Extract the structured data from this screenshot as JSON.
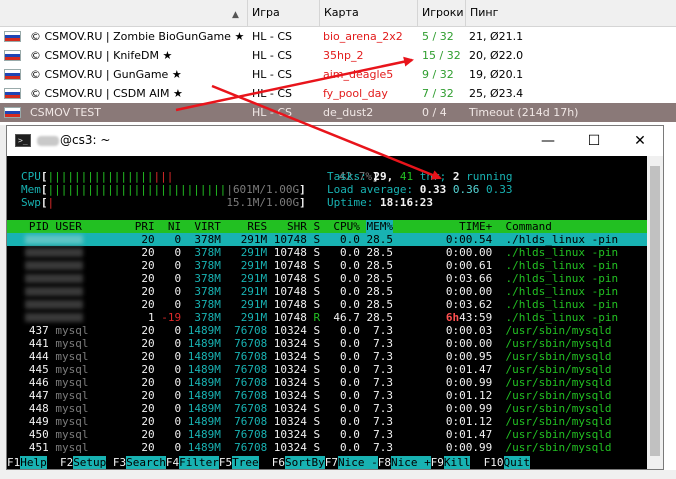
{
  "browser": {
    "columns": {
      "game": "Игра",
      "map": "Карта",
      "players": "Игроки",
      "ping": "Пинг"
    },
    "rows": [
      {
        "name": "© CSMOV.RU | Zombie BioGunGame ★",
        "game": "HL - CS",
        "map": "bio_arena_2x2",
        "players": "5 / 32",
        "ping": "21, Ø21.1"
      },
      {
        "name": "© CSMOV.RU | KnifeDM ★",
        "game": "HL - CS",
        "map": "35hp_2",
        "players": "15 / 32",
        "ping": "20, Ø22.0"
      },
      {
        "name": "© CSMOV.RU | GunGame ★",
        "game": "HL - CS",
        "map": "aim_deagle5",
        "players": "9 / 32",
        "ping": "19, Ø20.1"
      },
      {
        "name": "© CSMOV.RU | CSDM AIM ★",
        "game": "HL - CS",
        "map": "fy_pool_day",
        "players": "7 / 32",
        "ping": "25, Ø23.4"
      },
      {
        "name": "CSMOV TEST",
        "game": "HL - CS",
        "map": "de_dust2",
        "players": "0 / 4",
        "ping": "Timeout (214d 17h)"
      }
    ]
  },
  "window": {
    "title": "@cs3: ~",
    "minimize": "—",
    "maximize": "☐",
    "close": "✕"
  },
  "meters": {
    "cpu_label": "CPU",
    "cpu_value": "42.7%",
    "mem_label": "Mem",
    "mem_value": "601M/1.00G",
    "swp_label": "Swp",
    "swp_value": "15.1M/1.00G"
  },
  "summary": {
    "tasks_label": "Tasks:",
    "tasks_count": "29,",
    "thr_count": "41",
    "thr_label": "thr;",
    "running_count": "2",
    "running_label": "running",
    "load_label": "Load average:",
    "load1": "0.33",
    "load5": "0.36",
    "load15": "0.33",
    "uptime_label": "Uptime:",
    "uptime": "18:16:23"
  },
  "table": {
    "headers": [
      "PID",
      "USER",
      "PRI",
      "NI",
      "VIRT",
      "RES",
      "SHR",
      "S",
      "CPU%",
      "MEM%",
      "TIME+",
      "Command"
    ],
    "rows": [
      {
        "pid": "",
        "user": "",
        "pri": "20",
        "ni": "0",
        "virt": "378M",
        "res": "291M",
        "shr": "10748",
        "s": "S",
        "cpu": "0.0",
        "mem": "28.5",
        "time": "0:00.54",
        "cmd": "./hlds_linux -pin"
      },
      {
        "pid": "",
        "user": "",
        "pri": "20",
        "ni": "0",
        "virt": "378M",
        "res": "291M",
        "shr": "10748",
        "s": "S",
        "cpu": "0.0",
        "mem": "28.5",
        "time": "0:00.00",
        "cmd": "./hlds_linux -pin"
      },
      {
        "pid": "",
        "user": "",
        "pri": "20",
        "ni": "0",
        "virt": "378M",
        "res": "291M",
        "shr": "10748",
        "s": "S",
        "cpu": "0.0",
        "mem": "28.5",
        "time": "0:00.61",
        "cmd": "./hlds_linux -pin"
      },
      {
        "pid": "",
        "user": "",
        "pri": "20",
        "ni": "0",
        "virt": "378M",
        "res": "291M",
        "shr": "10748",
        "s": "S",
        "cpu": "0.0",
        "mem": "28.5",
        "time": "0:03.66",
        "cmd": "./hlds_linux -pin"
      },
      {
        "pid": "",
        "user": "",
        "pri": "20",
        "ni": "0",
        "virt": "378M",
        "res": "291M",
        "shr": "10748",
        "s": "S",
        "cpu": "0.0",
        "mem": "28.5",
        "time": "0:00.00",
        "cmd": "./hlds_linux -pin"
      },
      {
        "pid": "",
        "user": "",
        "pri": "20",
        "ni": "0",
        "virt": "378M",
        "res": "291M",
        "shr": "10748",
        "s": "S",
        "cpu": "0.0",
        "mem": "28.5",
        "time": "0:03.62",
        "cmd": "./hlds_linux -pin"
      },
      {
        "pid": "",
        "user": "",
        "pri": "1",
        "ni": "-19",
        "virt": "378M",
        "res": "291M",
        "shr": "10748",
        "s": "R",
        "cpu": "46.7",
        "mem": "28.5",
        "time_h": "6h",
        "time": "43:59",
        "cmd": "./hlds_linux -pin"
      },
      {
        "pid": "437",
        "user": "mysql",
        "pri": "20",
        "ni": "0",
        "virt": "1489M",
        "res": "76708",
        "shr": "10324",
        "s": "S",
        "cpu": "0.0",
        "mem": "7.3",
        "time": "0:00.03",
        "cmd": "/usr/sbin/mysqld"
      },
      {
        "pid": "441",
        "user": "mysql",
        "pri": "20",
        "ni": "0",
        "virt": "1489M",
        "res": "76708",
        "shr": "10324",
        "s": "S",
        "cpu": "0.0",
        "mem": "7.3",
        "time": "0:00.00",
        "cmd": "/usr/sbin/mysqld"
      },
      {
        "pid": "444",
        "user": "mysql",
        "pri": "20",
        "ni": "0",
        "virt": "1489M",
        "res": "76708",
        "shr": "10324",
        "s": "S",
        "cpu": "0.0",
        "mem": "7.3",
        "time": "0:00.95",
        "cmd": "/usr/sbin/mysqld"
      },
      {
        "pid": "445",
        "user": "mysql",
        "pri": "20",
        "ni": "0",
        "virt": "1489M",
        "res": "76708",
        "shr": "10324",
        "s": "S",
        "cpu": "0.0",
        "mem": "7.3",
        "time": "0:01.47",
        "cmd": "/usr/sbin/mysqld"
      },
      {
        "pid": "446",
        "user": "mysql",
        "pri": "20",
        "ni": "0",
        "virt": "1489M",
        "res": "76708",
        "shr": "10324",
        "s": "S",
        "cpu": "0.0",
        "mem": "7.3",
        "time": "0:00.99",
        "cmd": "/usr/sbin/mysqld"
      },
      {
        "pid": "447",
        "user": "mysql",
        "pri": "20",
        "ni": "0",
        "virt": "1489M",
        "res": "76708",
        "shr": "10324",
        "s": "S",
        "cpu": "0.0",
        "mem": "7.3",
        "time": "0:01.12",
        "cmd": "/usr/sbin/mysqld"
      },
      {
        "pid": "448",
        "user": "mysql",
        "pri": "20",
        "ni": "0",
        "virt": "1489M",
        "res": "76708",
        "shr": "10324",
        "s": "S",
        "cpu": "0.0",
        "mem": "7.3",
        "time": "0:00.99",
        "cmd": "/usr/sbin/mysqld"
      },
      {
        "pid": "449",
        "user": "mysql",
        "pri": "20",
        "ni": "0",
        "virt": "1489M",
        "res": "76708",
        "shr": "10324",
        "s": "S",
        "cpu": "0.0",
        "mem": "7.3",
        "time": "0:01.12",
        "cmd": "/usr/sbin/mysqld"
      },
      {
        "pid": "450",
        "user": "mysql",
        "pri": "20",
        "ni": "0",
        "virt": "1489M",
        "res": "76708",
        "shr": "10324",
        "s": "S",
        "cpu": "0.0",
        "mem": "7.3",
        "time": "0:01.47",
        "cmd": "/usr/sbin/mysqld"
      },
      {
        "pid": "451",
        "user": "mysql",
        "pri": "20",
        "ni": "0",
        "virt": "1489M",
        "res": "76708",
        "shr": "10324",
        "s": "S",
        "cpu": "0.0",
        "mem": "7.3",
        "time": "0:00.99",
        "cmd": "/usr/sbin/mysqld"
      }
    ]
  },
  "fkeys": [
    {
      "key": "F1",
      "label": "Help"
    },
    {
      "key": "F2",
      "label": "Setup"
    },
    {
      "key": "F3",
      "label": "Search"
    },
    {
      "key": "F4",
      "label": "Filter"
    },
    {
      "key": "F5",
      "label": "Tree"
    },
    {
      "key": "F6",
      "label": "SortBy"
    },
    {
      "key": "F7",
      "label": "Nice -"
    },
    {
      "key": "F8",
      "label": "Nice +"
    },
    {
      "key": "F9",
      "label": "Kill"
    },
    {
      "key": "F10",
      "label": "Quit"
    }
  ],
  "colors": {
    "flag_white": "#ffffff",
    "flag_blue": "#1f45b5",
    "flag_red": "#d52b1e",
    "arrow": "#e8141b",
    "selected_row": "#8a7978"
  }
}
